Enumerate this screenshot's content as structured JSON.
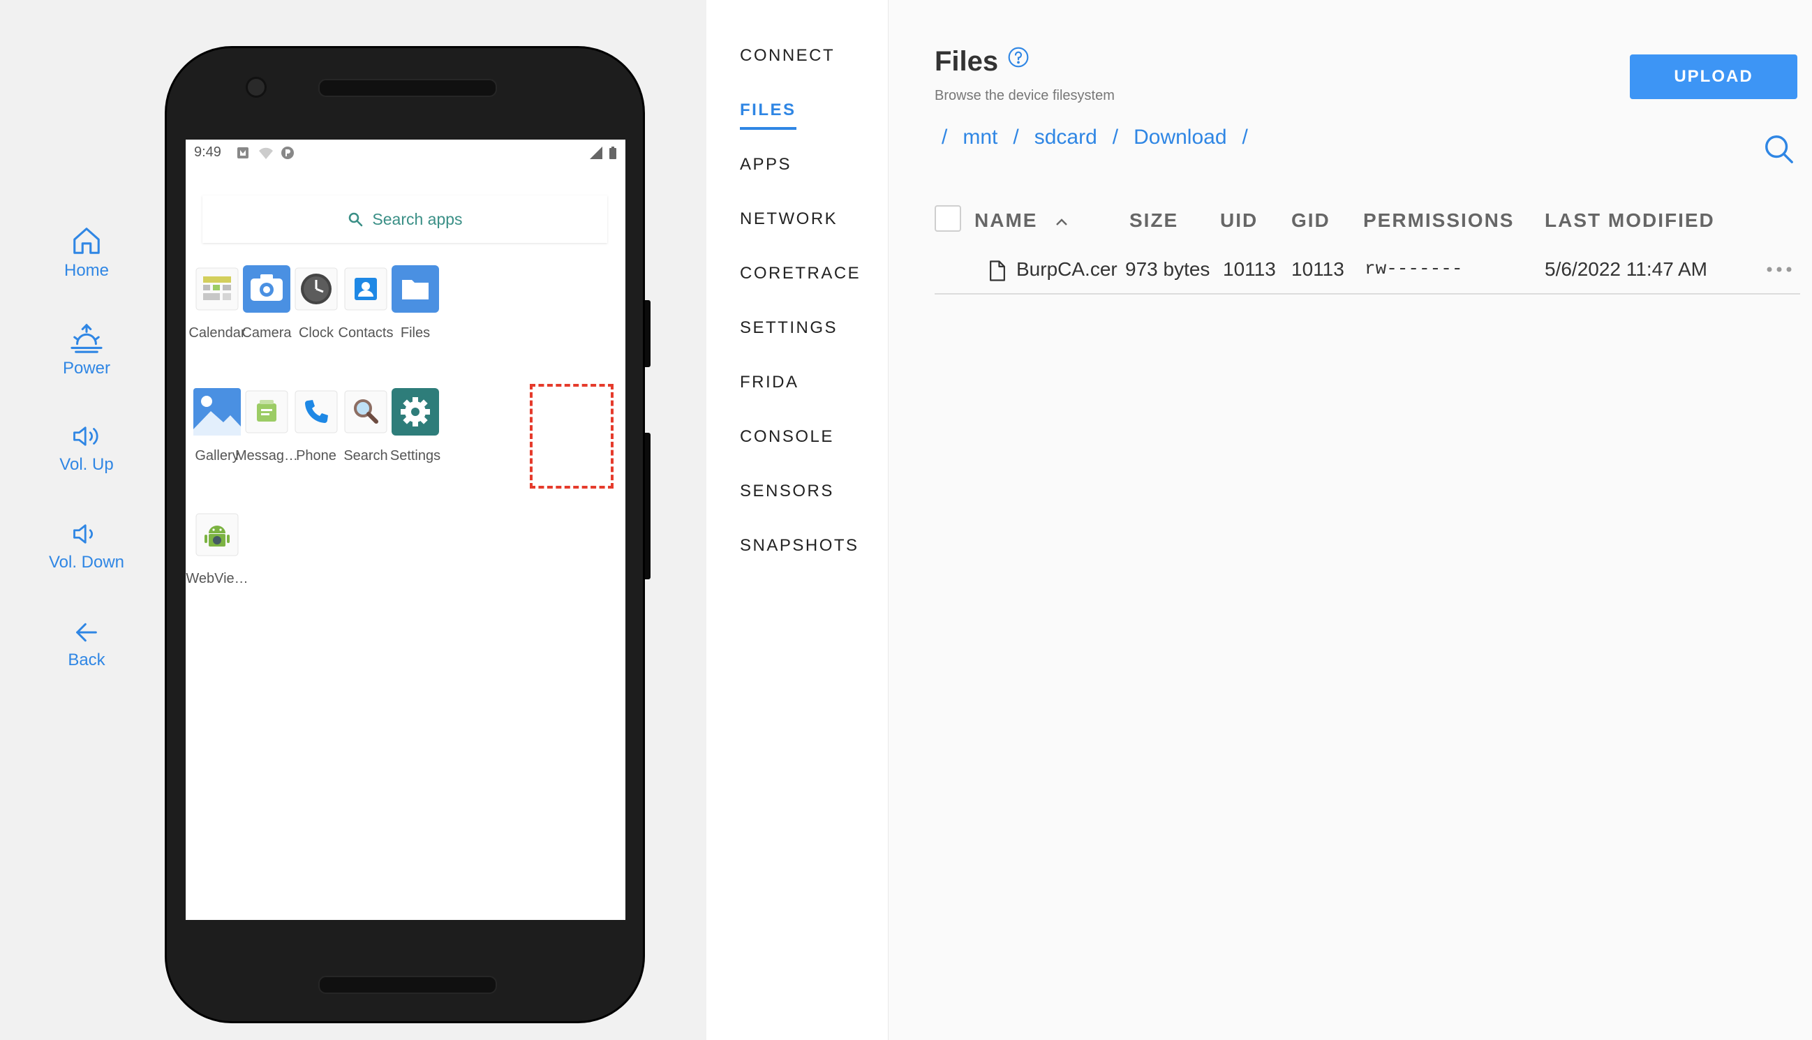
{
  "controls": {
    "home": "Home",
    "power": "Power",
    "vol_up": "Vol. Up",
    "vol_down": "Vol. Down",
    "back": "Back"
  },
  "phone": {
    "status_time": "9:49",
    "search_placeholder": "Search apps",
    "apps": [
      {
        "label": "Calendar",
        "icon": "calendar-icon"
      },
      {
        "label": "Camera",
        "icon": "camera-icon"
      },
      {
        "label": "Clock",
        "icon": "clock-icon"
      },
      {
        "label": "Contacts",
        "icon": "contacts-icon"
      },
      {
        "label": "Files",
        "icon": "files-icon"
      },
      {
        "label": "Gallery",
        "icon": "gallery-icon"
      },
      {
        "label": "Messag…",
        "icon": "messaging-icon"
      },
      {
        "label": "Phone",
        "icon": "phone-icon"
      },
      {
        "label": "Search",
        "icon": "search-icon"
      },
      {
        "label": "Settings",
        "icon": "settings-gear-icon"
      },
      {
        "label": "WebVie…",
        "icon": "android-webview-icon"
      }
    ],
    "highlight_color": "#e53b2c"
  },
  "nav": {
    "items": [
      "CONNECT",
      "FILES",
      "APPS",
      "NETWORK",
      "CORETRACE",
      "SETTINGS",
      "FRIDA",
      "CONSOLE",
      "SENSORS",
      "SNAPSHOTS"
    ],
    "active": "FILES"
  },
  "files": {
    "title": "Files",
    "subtitle": "Browse the device filesystem",
    "upload_label": "UPLOAD",
    "breadcrumb": [
      "mnt",
      "sdcard",
      "Download"
    ],
    "breadcrumb_sep": "/",
    "columns": [
      "NAME",
      "SIZE",
      "UID",
      "GID",
      "PERMISSIONS",
      "LAST MODIFIED"
    ],
    "rows": [
      {
        "name": "BurpCA.cer",
        "size": "973 bytes",
        "uid": "10113",
        "gid": "10113",
        "permissions": "rw-------",
        "modified": "5/6/2022 11:47 AM"
      }
    ]
  },
  "colors": {
    "accent": "#2f86e4",
    "upload_bg": "#3d95f5"
  }
}
